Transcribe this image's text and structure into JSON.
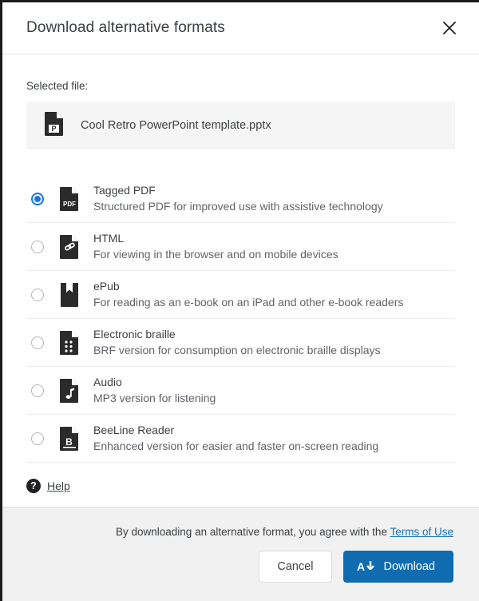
{
  "dialog": {
    "title": "Download alternative formats",
    "close_icon": "close-icon"
  },
  "selected_file": {
    "label": "Selected file:",
    "name": "Cool Retro PowerPoint template.pptx",
    "icon": "powerpoint-file-icon"
  },
  "options": [
    {
      "title": "Tagged PDF",
      "desc": "Structured PDF for improved use with assistive technology",
      "icon": "pdf-file-icon",
      "selected": true
    },
    {
      "title": "HTML",
      "desc": "For viewing in the browser and on mobile devices",
      "icon": "html-link-file-icon",
      "selected": false
    },
    {
      "title": "ePub",
      "desc": "For reading as an e-book on an iPad and other e-book readers",
      "icon": "epub-book-icon",
      "selected": false
    },
    {
      "title": "Electronic braille",
      "desc": "BRF version for consumption on electronic braille displays",
      "icon": "braille-file-icon",
      "selected": false
    },
    {
      "title": "Audio",
      "desc": "MP3 version for listening",
      "icon": "audio-note-file-icon",
      "selected": false
    },
    {
      "title": "BeeLine Reader",
      "desc": "Enhanced version for easier and faster on-screen reading",
      "icon": "beeline-file-icon",
      "selected": false
    }
  ],
  "help": {
    "label": "Help",
    "icon": "question-mark-icon"
  },
  "footer": {
    "terms_text": "By downloading an alternative format, you agree with the",
    "terms_link": "Terms of Use",
    "cancel_label": "Cancel",
    "download_label": "Download",
    "download_icon": "text-download-arrow-icon"
  },
  "colors": {
    "accent_radio": "#1a73e8",
    "download_button": "#0f6cb0",
    "link": "#1a6fb5",
    "footer_bg": "#f1f1f1",
    "chip_bg": "#f5f5f5",
    "text": "#3c4043"
  }
}
